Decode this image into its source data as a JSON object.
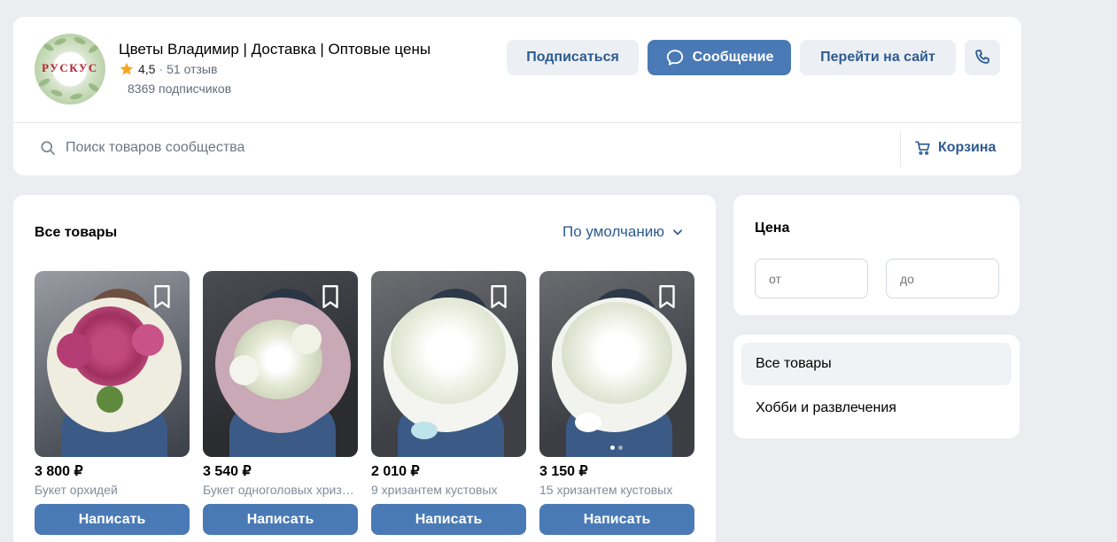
{
  "community": {
    "logo_text": "РУСКУС",
    "title": "Цветы Владимир | Доставка | Оптовые цены",
    "rating": "4,5",
    "rating_separator": "·",
    "reviews": "51 отзыв",
    "subscribers": "8369 подписчиков"
  },
  "actions": {
    "subscribe": "Подписаться",
    "message": "Сообщение",
    "website": "Перейти на сайт"
  },
  "search": {
    "placeholder": "Поиск товаров сообщества",
    "cart": "Корзина"
  },
  "products_section": {
    "title": "Все товары",
    "sort": "По умолчанию",
    "items": [
      {
        "price": "3 800 ₽",
        "name": "Букет орхидей",
        "button": "Написать"
      },
      {
        "price": "3 540 ₽",
        "name": "Букет одноголовых хризантем",
        "button": "Написать"
      },
      {
        "price": "2 010 ₽",
        "name": "9 хризантем кустовых",
        "button": "Написать"
      },
      {
        "price": "3 150 ₽",
        "name": "15 хризантем кустовых",
        "button": "Написать"
      }
    ]
  },
  "filters": {
    "price_title": "Цена",
    "from_placeholder": "от",
    "to_placeholder": "до"
  },
  "categories": [
    {
      "label": "Все товары",
      "active": true
    },
    {
      "label": "Хобби и развлечения",
      "active": false
    }
  ],
  "colors": {
    "accent": "#4a7ab5",
    "link": "#2d5b91",
    "background": "#ebedf0",
    "star": "#f5a623"
  },
  "icons": [
    "star-icon",
    "message-bubble-icon",
    "phone-icon",
    "search-icon",
    "cart-icon",
    "chevron-down-icon",
    "bookmark-icon"
  ]
}
